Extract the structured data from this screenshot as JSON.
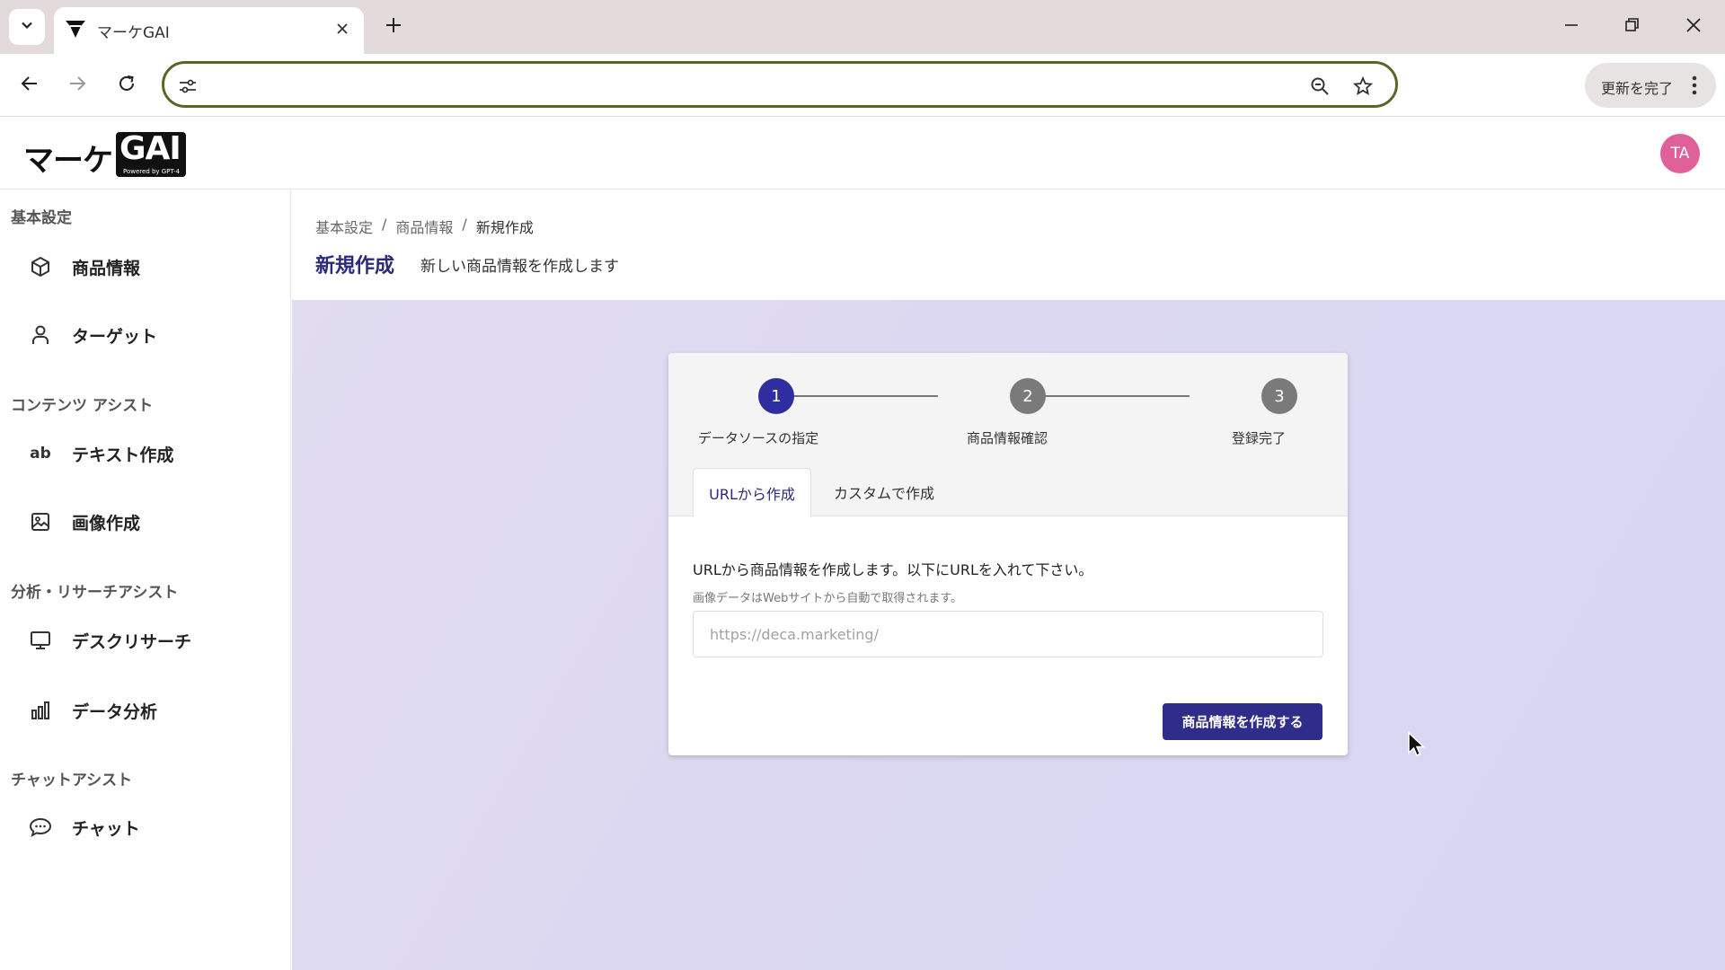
{
  "browser": {
    "tab_title": "マーケGAI",
    "address_value": "",
    "update_button_label": "更新を完了",
    "icons": {
      "tab_list": "chevron-down-icon",
      "tab_close": "close-icon",
      "new_tab": "plus-icon",
      "minimize": "minimize-icon",
      "restore": "restore-icon",
      "close_window": "close-icon",
      "back": "arrow-left-icon",
      "forward": "arrow-right-icon",
      "reload": "reload-icon",
      "site_info": "tune-icon",
      "zoom": "zoom-out-icon",
      "bookmark": "star-icon",
      "menu": "more-vertical-icon"
    }
  },
  "app": {
    "logo_text": "マーケ",
    "logo_box_text": "GAI",
    "logo_powered": "Powered by GPT-4",
    "avatar_initials": "TA",
    "avatar_color": "#e0619a"
  },
  "sidebar": {
    "sections": [
      {
        "label": "基本設定",
        "items": [
          {
            "label": "商品情報",
            "icon": "cube-icon"
          },
          {
            "label": "ターゲット",
            "icon": "person-icon"
          }
        ]
      },
      {
        "label": "コンテンツ アシスト",
        "items": [
          {
            "label": "テキスト作成",
            "icon": "ab-text-icon",
            "icon_text": "ab"
          },
          {
            "label": "画像作成",
            "icon": "image-icon"
          }
        ]
      },
      {
        "label": "分析・リサーチアシスト",
        "items": [
          {
            "label": "デスクリサーチ",
            "icon": "monitor-icon"
          },
          {
            "label": "データ分析",
            "icon": "bar-chart-icon"
          }
        ]
      },
      {
        "label": "チャットアシスト",
        "items": [
          {
            "label": "チャット",
            "icon": "chat-bubble-icon"
          }
        ]
      }
    ]
  },
  "page": {
    "breadcrumb": [
      "基本設定",
      "/",
      "商品情報",
      "/",
      "新規作成"
    ],
    "title": "新規作成",
    "subtitle": "新しい商品情報を作成します"
  },
  "wizard": {
    "steps": [
      {
        "number": "1",
        "label": "データソースの指定",
        "active": true
      },
      {
        "number": "2",
        "label": "商品情報確認",
        "active": false
      },
      {
        "number": "3",
        "label": "登録完了",
        "active": false
      }
    ],
    "tabs": [
      {
        "label": "URLから作成",
        "selected": true
      },
      {
        "label": "カスタムで作成",
        "selected": false
      }
    ],
    "description": "URLから商品情報を作成します。以下にURLを入れて下さい。",
    "note": "画像データはWebサイトから自動で取得されます。",
    "url_input_value": "",
    "url_placeholder": "https://deca.marketing/",
    "submit_label": "商品情報を作成する",
    "accent_color": "#2f2da0"
  }
}
